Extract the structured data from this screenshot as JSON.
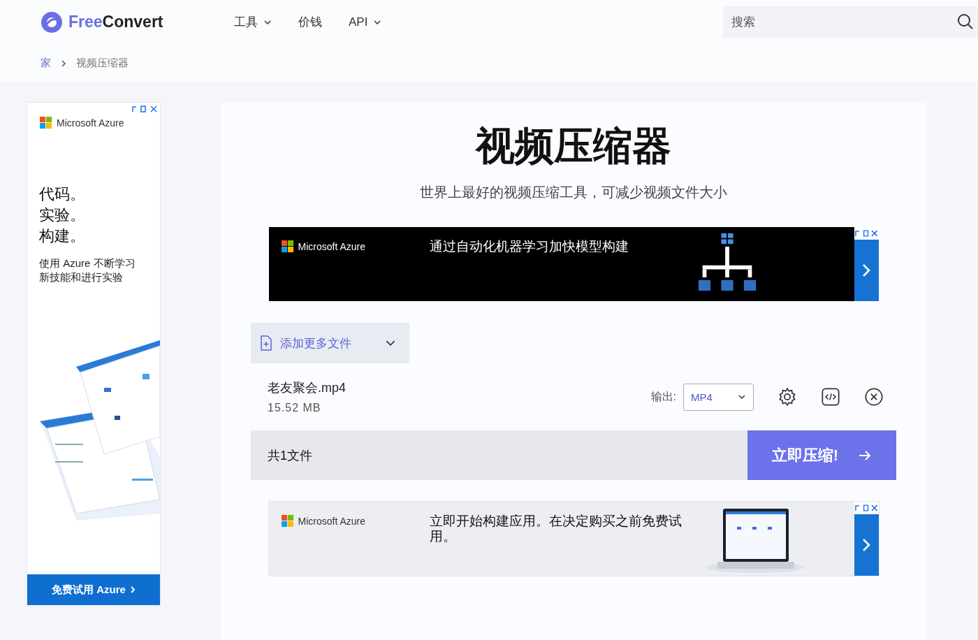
{
  "header": {
    "logo": {
      "first": "Free",
      "second": "Convert"
    },
    "nav": [
      {
        "label": "工具",
        "has_menu": true
      },
      {
        "label": "价钱",
        "has_menu": false
      },
      {
        "label": "API",
        "has_menu": true
      }
    ],
    "search": {
      "placeholder": "搜索"
    }
  },
  "breadcrumb": [
    "家",
    "视频压缩器"
  ],
  "side_ad": {
    "brand": "Microsoft Azure",
    "headline": [
      "代码。",
      "实验。",
      "构建。"
    ],
    "body": "使用 Azure 不断学习新技能和进行实验",
    "button": "免费试用 Azure"
  },
  "main": {
    "title": "视频压缩器",
    "subtitle": "世界上最好的视频压缩工具，可减少视频文件大小",
    "top_ad": {
      "brand": "Microsoft Azure",
      "text": "通过自动化机器学习加快模型构建"
    },
    "add_files": "添加更多文件",
    "file": {
      "name": "老友聚会.mp4",
      "size": "15.52 MB",
      "output_label": "输出:",
      "format": "MP4"
    },
    "summary": "共1文件",
    "compress_button": "立即压缩!",
    "bottom_ad": {
      "brand": "Microsoft Azure",
      "text": "立即开始构建应用。在决定购买之前免费试用。"
    }
  }
}
